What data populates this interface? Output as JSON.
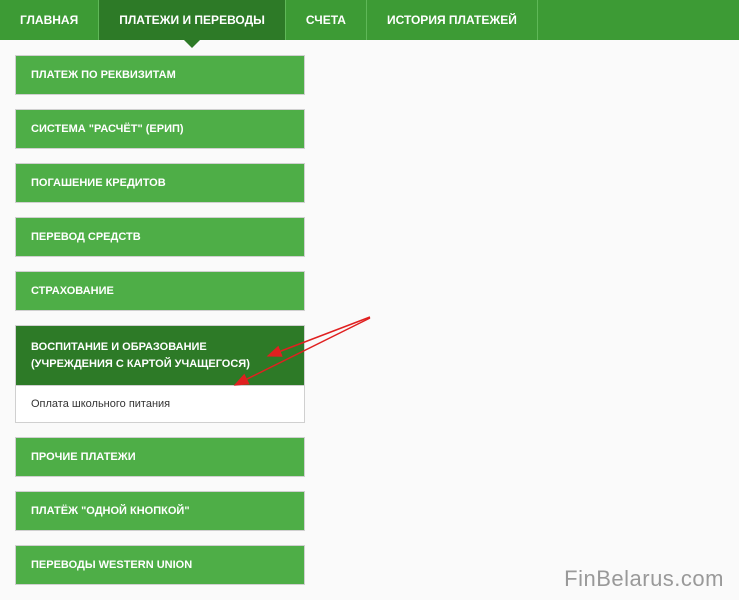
{
  "topNav": {
    "items": [
      {
        "label": "ГЛАВНАЯ",
        "active": false
      },
      {
        "label": "ПЛАТЕЖИ И ПЕРЕВОДЫ",
        "active": true
      },
      {
        "label": "СЧЕТА",
        "active": false
      },
      {
        "label": "ИСТОРИЯ ПЛАТЕЖЕЙ",
        "active": false
      }
    ]
  },
  "menu": {
    "items": [
      {
        "label": "ПЛАТЕЖ ПО РЕКВИЗИТАМ"
      },
      {
        "label": "СИСТЕМА \"РАСЧЁТ\" (ЕРИП)"
      },
      {
        "label": "ПОГАШЕНИЕ КРЕДИТОВ"
      },
      {
        "label": "ПЕРЕВОД СРЕДСТВ"
      },
      {
        "label": "СТРАХОВАНИЕ"
      }
    ],
    "expandedItem": {
      "label": "ВОСПИТАНИЕ И ОБРАЗОВАНИЕ (УЧРЕЖДЕНИЯ С КАРТОЙ УЧАЩЕГОСЯ)",
      "subItems": [
        {
          "label": "Оплата школьного питания"
        }
      ]
    },
    "itemsAfter": [
      {
        "label": "ПРОЧИЕ ПЛАТЕЖИ"
      },
      {
        "label": "ПЛАТЁЖ \"ОДНОЙ КНОПКОЙ\""
      },
      {
        "label": "ПЕРЕВОДЫ WESTERN UNION"
      }
    ]
  },
  "watermark": "FinBelarus.com"
}
